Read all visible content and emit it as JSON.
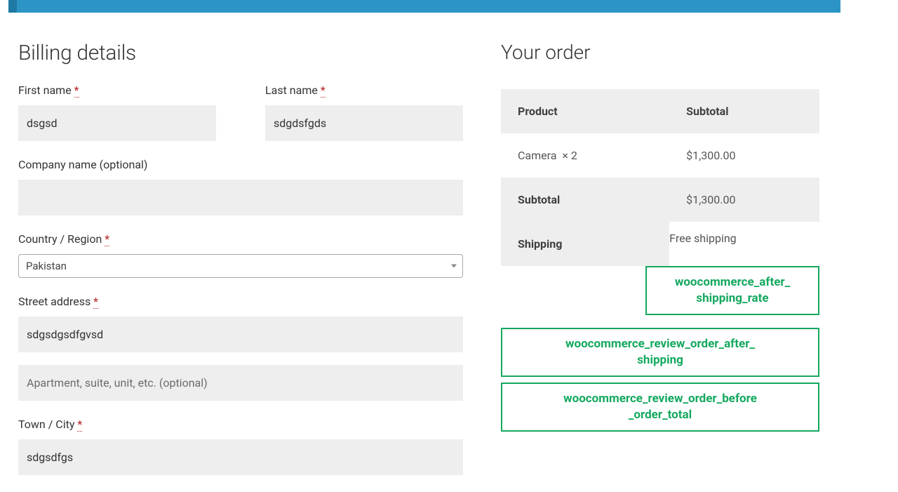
{
  "billing": {
    "heading": "Billing details",
    "first_name": {
      "label": "First name",
      "value": "dsgsd"
    },
    "last_name": {
      "label": "Last name",
      "value": "sdgdsfgds"
    },
    "company": {
      "label": "Company name (optional)",
      "value": ""
    },
    "country": {
      "label": "Country / Region",
      "value": "Pakistan"
    },
    "street": {
      "label": "Street address",
      "value": "sdgsdgsdfgvsd",
      "placeholder2": "Apartment, suite, unit, etc. (optional)"
    },
    "town": {
      "label": "Town / City",
      "value": "sdgsdfgs"
    }
  },
  "order": {
    "heading": "Your order",
    "col_product": "Product",
    "col_subtotal": "Subtotal",
    "item_name": "Camera",
    "item_qty": "× 2",
    "item_subtotal": "$1,300.00",
    "subtotal_label": "Subtotal",
    "subtotal_value": "$1,300.00",
    "shipping_label": "Shipping",
    "shipping_value": "Free shipping"
  },
  "hooks": {
    "after_shipping_rate": "woocommerce_after_shipping_rate",
    "review_after_shipping": "woocommerce_review_order_after_shipping",
    "review_before_total": "woocommerce_review_order_before_order_total"
  },
  "required_marker": "*"
}
